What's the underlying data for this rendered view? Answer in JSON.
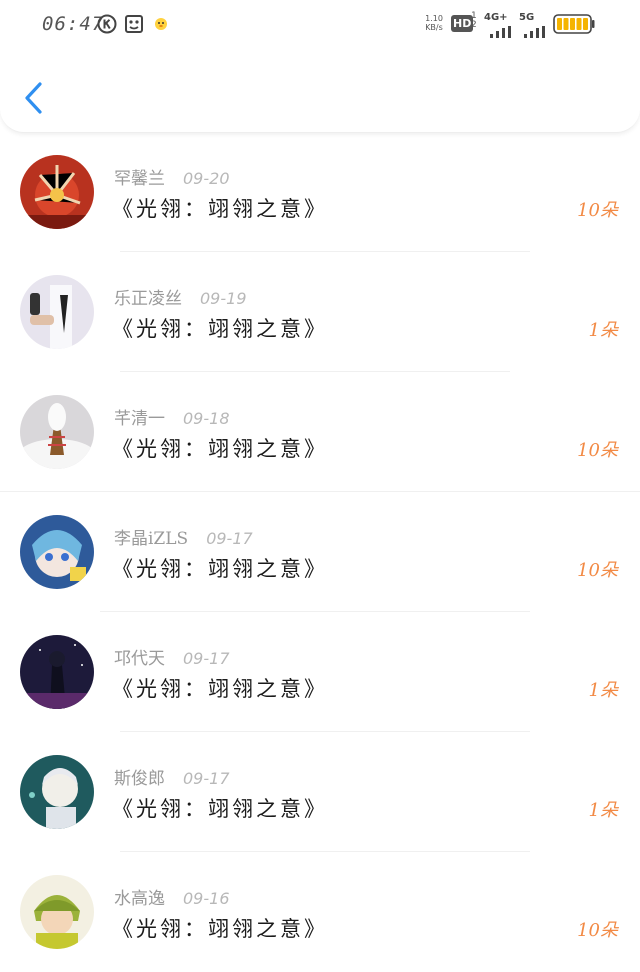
{
  "status_bar": {
    "time": "06:47",
    "net_speed_value": "1.10",
    "net_speed_unit": "KB/s",
    "hd_label": "HD",
    "hd_sub": "1",
    "hd_sub2": "2",
    "net_4g": "4G+",
    "net_5g": "5G",
    "battery_color": "#f5b400",
    "icons": [
      "k-circle-icon",
      "cat-face-icon",
      "chick-icon"
    ]
  },
  "header": {
    "back_icon": "chevron-left-icon",
    "accent_color": "#2f8ff0"
  },
  "items": [
    {
      "name": "罕馨兰",
      "date": "09-20",
      "title": "《光翎：翊翎之意》",
      "amount": "10朵",
      "avatar": "avatar-1"
    },
    {
      "name": "乐正凌丝",
      "date": "09-19",
      "title": "《光翎：翊翎之意》",
      "amount": "1朵",
      "avatar": "avatar-2"
    },
    {
      "name": "芊清一",
      "date": "09-18",
      "title": "《光翎：翊翎之意》",
      "amount": "10朵",
      "avatar": "avatar-3"
    },
    {
      "name": "李晶iZLS",
      "date": "09-17",
      "title": "《光翎：翊翎之意》",
      "amount": "10朵",
      "avatar": "avatar-4"
    },
    {
      "name": "邛代天",
      "date": "09-17",
      "title": "《光翎：翊翎之意》",
      "amount": "1朵",
      "avatar": "avatar-5"
    },
    {
      "name": "斯俊郎",
      "date": "09-17",
      "title": "《光翎：翊翎之意》",
      "amount": "1朵",
      "avatar": "avatar-6"
    },
    {
      "name": "水高逸",
      "date": "09-16",
      "title": "《光翎：翊翎之意》",
      "amount": "10朵",
      "avatar": "avatar-7"
    }
  ]
}
